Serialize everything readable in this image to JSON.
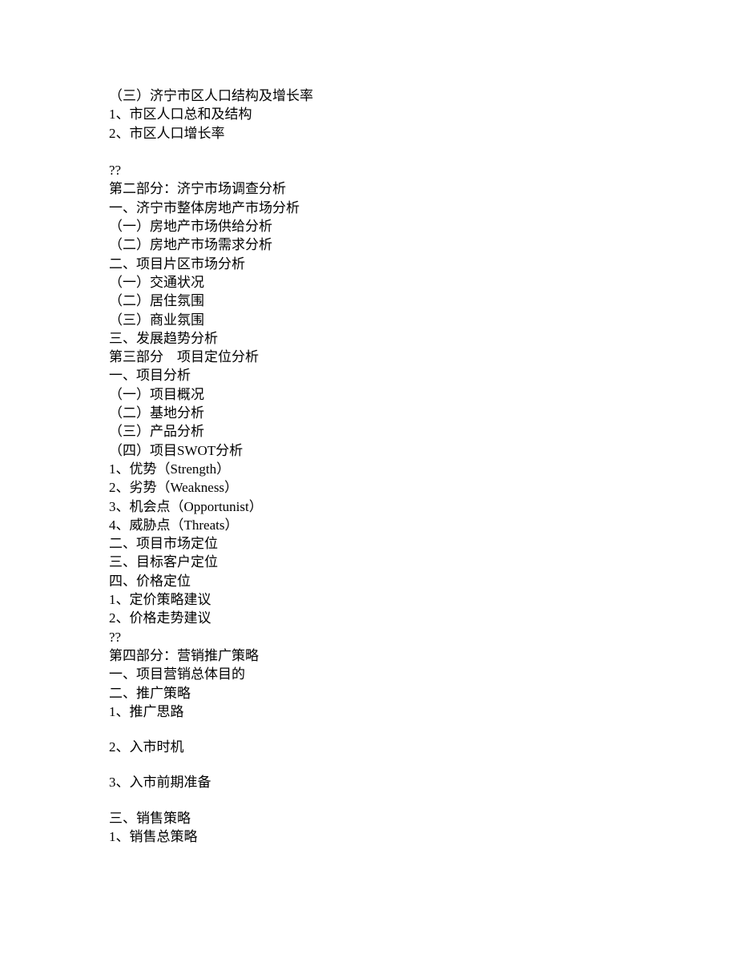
{
  "document": {
    "lines": [
      "（三）济宁市区人口结构及增长率",
      "1、市区人口总和及结构",
      "2、市区人口增长率",
      "",
      "??",
      "第二部分：济宁市场调查分析",
      "一、济宁市整体房地产市场分析",
      "（一）房地产市场供给分析",
      "（二）房地产市场需求分析",
      "二、项目片区市场分析",
      "（一）交通状况",
      "（二）居住氛围",
      "（三）商业氛围",
      "三、发展趋势分析",
      "第三部分    项目定位分析",
      "一、项目分析",
      "（一）项目概况",
      "（二）基地分析",
      "（三）产品分析",
      "（四）项目SWOT分析",
      "1、优势（Strength）",
      "2、劣势（Weakness）",
      "3、机会点（Opportunist）",
      "4、威胁点（Threats）",
      "二、项目市场定位",
      "三、目标客户定位",
      "四、价格定位",
      "1、定价策略建议",
      "2、价格走势建议",
      "??",
      "第四部分：营销推广策略",
      "一、项目营销总体目的",
      "二、推广策略",
      "1、推广思路",
      "2、入市时机",
      "3、入市前期准备",
      "三、销售策略",
      "1、销售总策略"
    ]
  }
}
